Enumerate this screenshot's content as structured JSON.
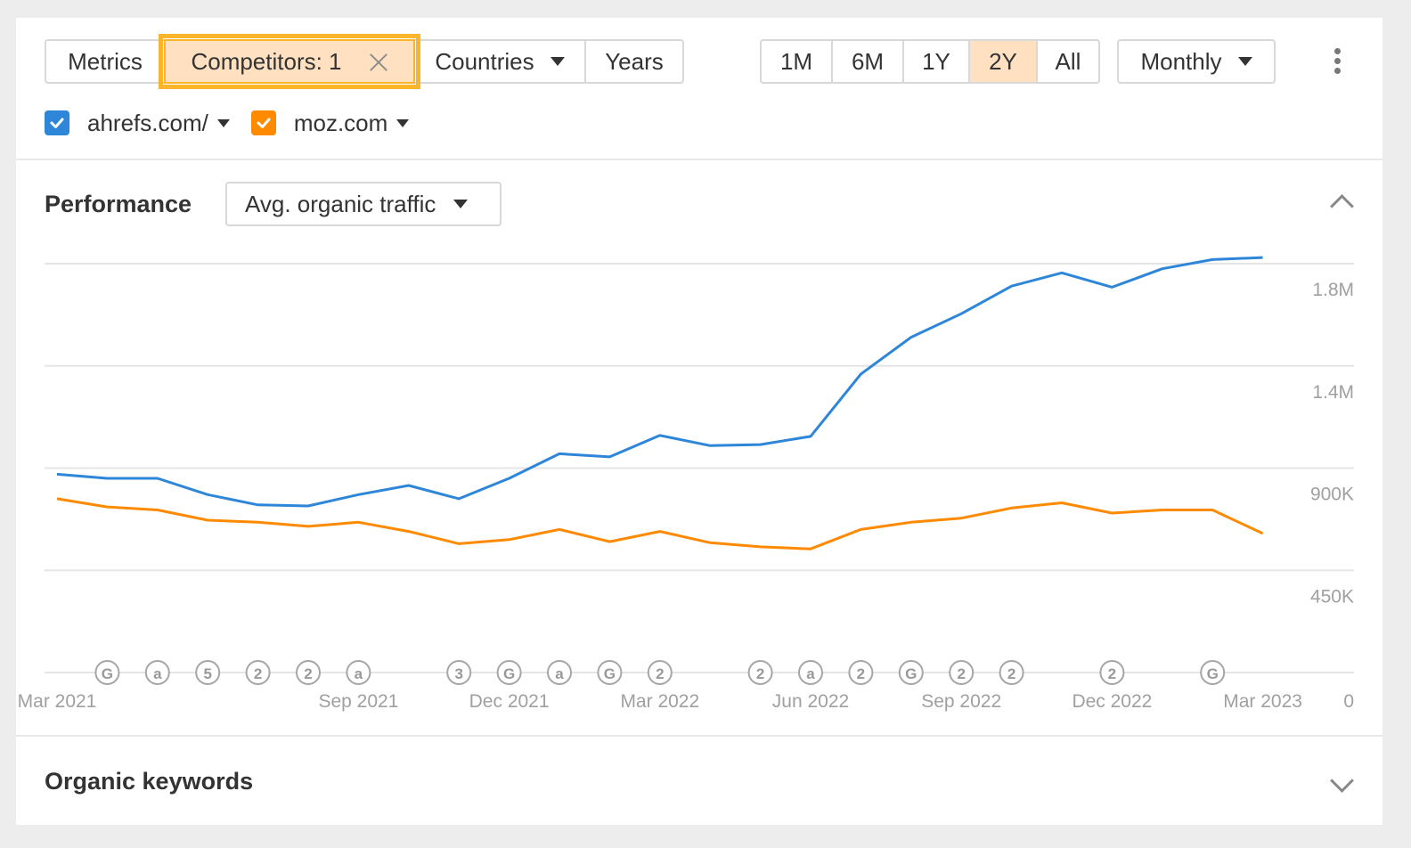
{
  "toolbar": {
    "metrics_label": "Metrics",
    "competitors_label": "Competitors: 1",
    "countries_label": "Countries",
    "years_label": "Years",
    "ranges": [
      "1M",
      "6M",
      "1Y",
      "2Y",
      "All"
    ],
    "active_range": "2Y",
    "interval_label": "Monthly"
  },
  "legend": {
    "items": [
      {
        "label": "ahrefs.com/",
        "color": "#2e86d9"
      },
      {
        "label": "moz.com",
        "color": "#ff8a00"
      }
    ]
  },
  "performance": {
    "title": "Performance",
    "metric_select": "Avg. organic traffic"
  },
  "organic_keywords": {
    "title": "Organic keywords"
  },
  "colors": {
    "accent": "#ffe1c1",
    "highlight": "#fbb52b",
    "ahrefs": "#2e86d9",
    "moz": "#ff8a00"
  },
  "chart_data": {
    "type": "line",
    "x": [
      "Mar 2021",
      "Apr 2021",
      "May 2021",
      "Jun 2021",
      "Jul 2021",
      "Aug 2021",
      "Sep 2021",
      "Oct 2021",
      "Nov 2021",
      "Dec 2021",
      "Jan 2022",
      "Feb 2022",
      "Mar 2022",
      "Apr 2022",
      "May 2022",
      "Jun 2022",
      "Jul 2022",
      "Aug 2022",
      "Sep 2022",
      "Oct 2022",
      "Nov 2022",
      "Dec 2022",
      "Jan 2023",
      "Feb 2023",
      "Mar 2023"
    ],
    "x_tick_labels": [
      "Mar 2021",
      "Sep 2021",
      "Dec 2021",
      "Mar 2022",
      "Jun 2022",
      "Sep 2022",
      "Dec 2022",
      "Mar 2023"
    ],
    "y_tick_labels": [
      "1.8M",
      "1.4M",
      "900K",
      "450K",
      "0"
    ],
    "ylim": [
      0,
      1800000
    ],
    "series": [
      {
        "name": "ahrefs.com/",
        "color": "#2e86d9",
        "values": [
          970000,
          950000,
          950000,
          870000,
          820000,
          815000,
          870000,
          915000,
          850000,
          950000,
          1070000,
          1055000,
          1160000,
          1110000,
          1115000,
          1155000,
          1460000,
          1640000,
          1755000,
          1890000,
          1955000,
          1885000,
          1975000,
          2020000,
          2030000
        ]
      },
      {
        "name": "moz.com",
        "color": "#ff8a00",
        "values": [
          850000,
          810000,
          795000,
          745000,
          735000,
          715000,
          735000,
          690000,
          630000,
          650000,
          700000,
          640000,
          690000,
          635000,
          615000,
          605000,
          700000,
          735000,
          755000,
          805000,
          830000,
          780000,
          795000,
          795000,
          680000
        ]
      }
    ],
    "annotations": [
      {
        "label": "G",
        "x": "Apr 2021"
      },
      {
        "label": "a",
        "x": "May 2021"
      },
      {
        "label": "5",
        "x": "Jun 2021"
      },
      {
        "label": "2",
        "x": "Jul 2021"
      },
      {
        "label": "2",
        "x": "Aug 2021"
      },
      {
        "label": "a",
        "x": "Sep 2021"
      },
      {
        "label": "3",
        "x": "Nov 2021"
      },
      {
        "label": "G",
        "x": "Dec 2021"
      },
      {
        "label": "a",
        "x": "Jan 2022"
      },
      {
        "label": "G",
        "x": "Feb 2022"
      },
      {
        "label": "2",
        "x": "Mar 2022"
      },
      {
        "label": "2",
        "x": "May 2022"
      },
      {
        "label": "a",
        "x": "Jun 2022"
      },
      {
        "label": "2",
        "x": "Jul 2022"
      },
      {
        "label": "G",
        "x": "Aug 2022"
      },
      {
        "label": "2",
        "x": "Sep 2022"
      },
      {
        "label": "2",
        "x": "Oct 2022"
      },
      {
        "label": "2",
        "x": "Dec 2022"
      },
      {
        "label": "G",
        "x": "Feb 2023"
      }
    ],
    "grid": true,
    "legend_position": "top-left"
  }
}
